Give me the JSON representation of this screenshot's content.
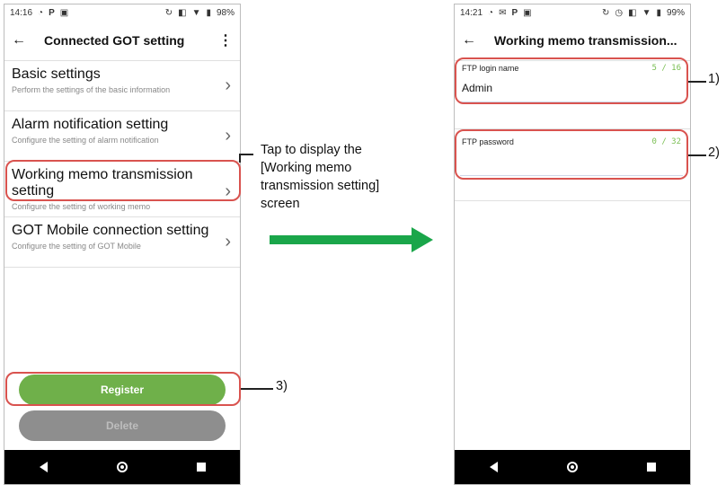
{
  "screen1": {
    "status": {
      "time": "14:16",
      "battery": "98%"
    },
    "title": "Connected GOT setting",
    "items": [
      {
        "label": "Basic settings",
        "desc": "Perform the settings of the basic information"
      },
      {
        "label": "Alarm notification setting",
        "desc": "Configure the setting of alarm notification"
      },
      {
        "label": "Working memo transmission setting",
        "desc": "Configure the setting of working memo"
      },
      {
        "label": "GOT Mobile connection setting",
        "desc": "Configure the setting of GOT Mobile"
      }
    ],
    "register_label": "Register",
    "delete_label": "Delete"
  },
  "screen2": {
    "status": {
      "time": "14:21",
      "battery": "99%"
    },
    "title": "Working memo transmission...",
    "login": {
      "label": "FTP login name",
      "count": "5 / 16",
      "value": "Admin"
    },
    "password": {
      "label": "FTP password",
      "count": "0 / 32",
      "value": ""
    }
  },
  "annotations": {
    "tap_text": [
      "Tap to display the",
      "[Working memo",
      "transmission setting]",
      "screen"
    ],
    "n1": "1)",
    "n2": "2)",
    "n3": "3)"
  },
  "colors": {
    "accent_green": "#6fb04a",
    "callout_red": "#d9534f",
    "arrow_green": "#1aa64a"
  }
}
